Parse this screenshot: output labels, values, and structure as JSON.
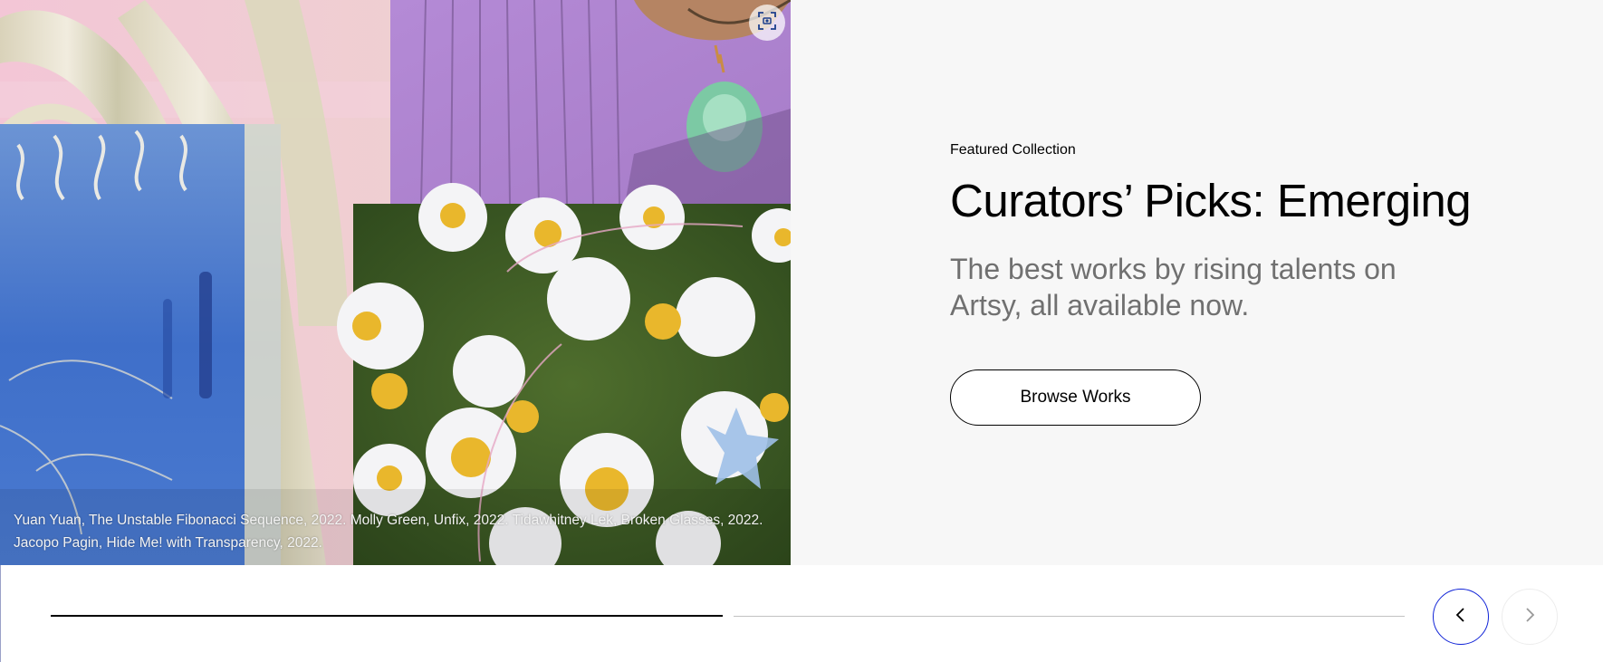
{
  "hero": {
    "eyebrow": "Featured Collection",
    "title": "Curators’ Picks: Emerging",
    "subtitle": "The best works by rising talents on Artsy, all available now.",
    "cta_label": "Browse Works",
    "caption": "Yuan Yuan, The Unstable Fibonacci Sequence, 2022. Molly Green, Unfix, 2022. Tidawhitney Lek, Broken Glasses, 2022. Jacopo Pagin, Hide Me! with Transparency, 2022."
  },
  "icons": {
    "view_in_room": "view-in-room-icon",
    "previous": "chevron-left-icon",
    "next": "chevron-right-icon"
  },
  "carousel": {
    "slide_count": 2,
    "active_slide": 1
  },
  "colors": {
    "panel_bg": "#f7f7f7",
    "subtitle_text": "#707070",
    "active_focus": "#1023d7",
    "progress_active": "#000000",
    "progress_inactive": "#c2c2c2"
  }
}
